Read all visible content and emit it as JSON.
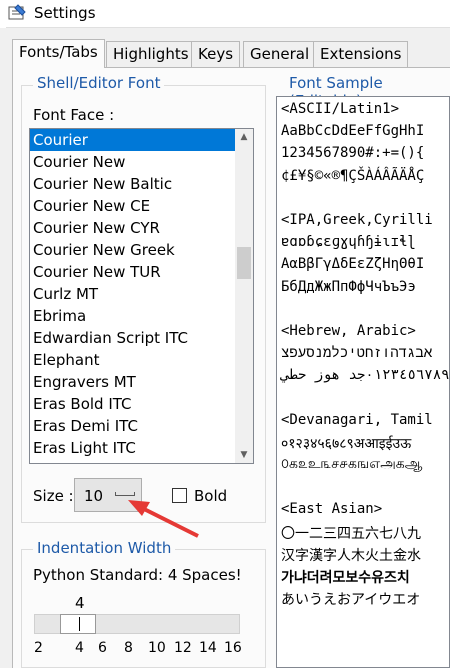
{
  "window": {
    "title": "Settings"
  },
  "tabs": [
    {
      "label": "Fonts/Tabs",
      "active": true
    },
    {
      "label": "Highlights"
    },
    {
      "label": "Keys"
    },
    {
      "label": "General"
    },
    {
      "label": "Extensions"
    }
  ],
  "font_group": {
    "title": "Shell/Editor Font",
    "face_label": "Font Face :",
    "fonts": [
      "Courier",
      "Courier New",
      "Courier New Baltic",
      "Courier New CE",
      "Courier New CYR",
      "Courier New Greek",
      "Courier New TUR",
      "Curlz MT",
      "Ebrima",
      "Edwardian Script ITC",
      "Elephant",
      "Engravers MT",
      "Eras Bold ITC",
      "Eras Demi ITC",
      "Eras Light ITC"
    ],
    "selected_font": "Courier",
    "size_label": "Size :",
    "size_value": "10",
    "bold_label": "Bold"
  },
  "indent_group": {
    "title": "Indentation Width",
    "desc": "Python Standard: 4 Spaces!",
    "current_value": "4",
    "ticks": [
      "2",
      "4",
      "6",
      "8",
      "10",
      "12",
      "14",
      "16"
    ]
  },
  "sample": {
    "title": "Font Sample (Editable)",
    "lines": [
      "<ASCII/Latin1>",
      "AaBbCcDdEeFfGgHhI",
      "1234567890#:+=(){",
      "¢£¥§©«®¶ÇŠÀÁÂÃÄÅÇ",
      "",
      "<IPA,Greek,Cyrilli",
      "ɐɑɒɓɕɛɡɣɥɦɧɨɩɪɬɭ",
      "ΑαΒβΓγΔδΕεΖζΗηΘθΙ",
      "БбДдЖжПпФфЧчЪъЭэ",
      "",
      "<Hebrew, Arabic>",
      "אבגדהוזחטיכלמנסעפצ",
      "٠١٢٣٤٥٦٧٨٩جد هوز حطي",
      "",
      "<Devanagari, Tamil",
      "०१२३४५६७८९अआइईउऊ",
      "௦க௨உ௩ச௪கஙஎஅகஆ",
      "",
      "<East Asian>",
      "〇一二三四五六七八九",
      "汉字漢字人木火土金水",
      "가냐더려모보수유즈치",
      "あいうえおアイウエオ"
    ]
  }
}
